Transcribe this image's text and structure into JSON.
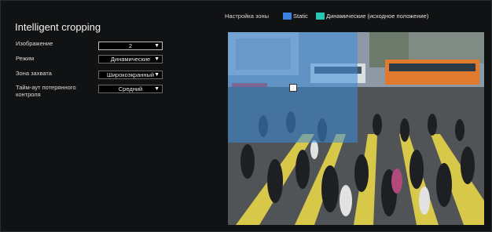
{
  "panel": {
    "title": "Intelligent cropping"
  },
  "settings": [
    {
      "label": "Изображение",
      "value": "2"
    },
    {
      "label": "Режим",
      "value": "Динамические"
    },
    {
      "label": "Зона захвата",
      "value": "Широкоэкранный"
    },
    {
      "label": "Тайм-аут потерянного контроля",
      "value": "Средний"
    }
  ],
  "zone": {
    "header": "Настройка зоны",
    "legend": [
      {
        "label": "Static",
        "color": "#3d7fe0"
      },
      {
        "label": "Динамические (исходное положение)",
        "color": "#27c7b5"
      }
    ]
  },
  "icons": {
    "dropdown": "triangle-down-icon",
    "zone_handle": "square-handle-icon"
  }
}
